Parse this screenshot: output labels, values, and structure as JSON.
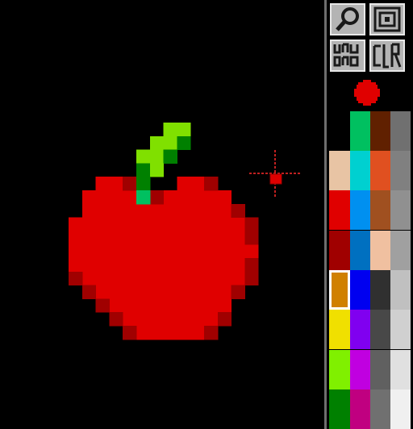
{
  "toolbar": {
    "tools": [
      {
        "name": "zoom-tool",
        "icon": "magnifier-icon"
      },
      {
        "name": "fill-tool",
        "icon": "concentric-square-icon"
      },
      {
        "name": "undo-tool",
        "icon": "undo-glyph-icon"
      },
      {
        "name": "clear-tool",
        "icon": "clear-glyph-icon"
      }
    ]
  },
  "current_color": "#e00000",
  "palette": {
    "selected_index": 4,
    "columns": [
      [
        "#000000",
        "#e8c4a4",
        "#e00000",
        "#a00000",
        "#d08000",
        "#f0e000",
        "#80f000",
        "#008000"
      ],
      [
        "#00c060",
        "#00d0d0",
        "#0090f0",
        "#0070c0",
        "#0000f0",
        "#8000f0",
        "#c000e0",
        "#c00080"
      ],
      [
        "#602000",
        "#e05020",
        "#a05020",
        "#f0c0a0",
        "#303030",
        "#484848",
        "#606060",
        "#707070"
      ],
      [
        "#707070",
        "#808080",
        "#909090",
        "#a0a0a0",
        "#c0c0c0",
        "#d0d0d0",
        "#e0e0e0",
        "#f0f0f0"
      ]
    ]
  },
  "artwork": {
    "subject": "pixel-art apple",
    "colors": {
      "body": "#e00000",
      "shade": "#a00000",
      "stem": "#008000",
      "leaf": "#80e000",
      "highlight": "#00c060"
    }
  },
  "cursor": {
    "icon": "crosshair-icon",
    "color": "#c02020"
  }
}
